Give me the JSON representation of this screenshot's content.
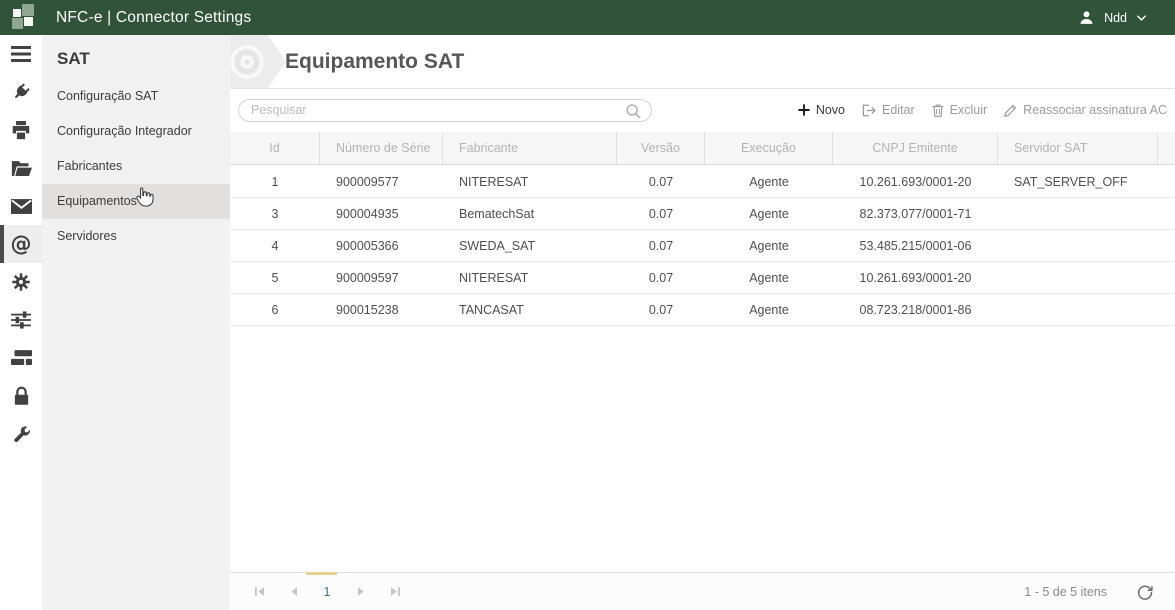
{
  "header": {
    "title": "NFC-e | Connector Settings",
    "user_name": "Ndd"
  },
  "sidebar": {
    "title": "SAT",
    "items": [
      {
        "label": "Configuração SAT",
        "active": false
      },
      {
        "label": "Configuração Integrador",
        "active": false
      },
      {
        "label": "Fabricantes",
        "active": false
      },
      {
        "label": "Equipamentos",
        "active": true
      },
      {
        "label": "Servidores",
        "active": false
      }
    ]
  },
  "main": {
    "page_title": "Equipamento SAT",
    "search": {
      "placeholder": "Pesquisar",
      "value": ""
    },
    "toolbar": {
      "new_label": "Novo",
      "edit_label": "Editar",
      "delete_label": "Excluir",
      "reassign_label": "Reassociar assinatura AC"
    },
    "table": {
      "columns": [
        "Id",
        "Número de Série",
        "Fabricante",
        "Versão",
        "Execução",
        "CNPJ Emitente",
        "Servidor SAT"
      ],
      "rows": [
        [
          "1",
          "900009577",
          "NITERESAT",
          "0.07",
          "Agente",
          "10.261.693/0001-20",
          "SAT_SERVER_OFF"
        ],
        [
          "3",
          "900004935",
          "BematechSat",
          "0.07",
          "Agente",
          "82.373.077/0001-71",
          ""
        ],
        [
          "4",
          "900005366",
          "SWEDA_SAT",
          "0.07",
          "Agente",
          "53.485.215/0001-06",
          ""
        ],
        [
          "5",
          "900009597",
          "NITERESAT",
          "0.07",
          "Agente",
          "10.261.693/0001-20",
          ""
        ],
        [
          "6",
          "900015238",
          "TANCASAT",
          "0.07",
          "Agente",
          "08.723.218/0001-86",
          ""
        ]
      ]
    },
    "pagination": {
      "current_page": "1",
      "items_label": "1 - 5 de 5 itens"
    }
  },
  "colors": {
    "header_green": "#30533a",
    "logo_sage": "#8fa693",
    "active_page_indicator": "#e6d08d",
    "page_number": "#3d7a99"
  }
}
